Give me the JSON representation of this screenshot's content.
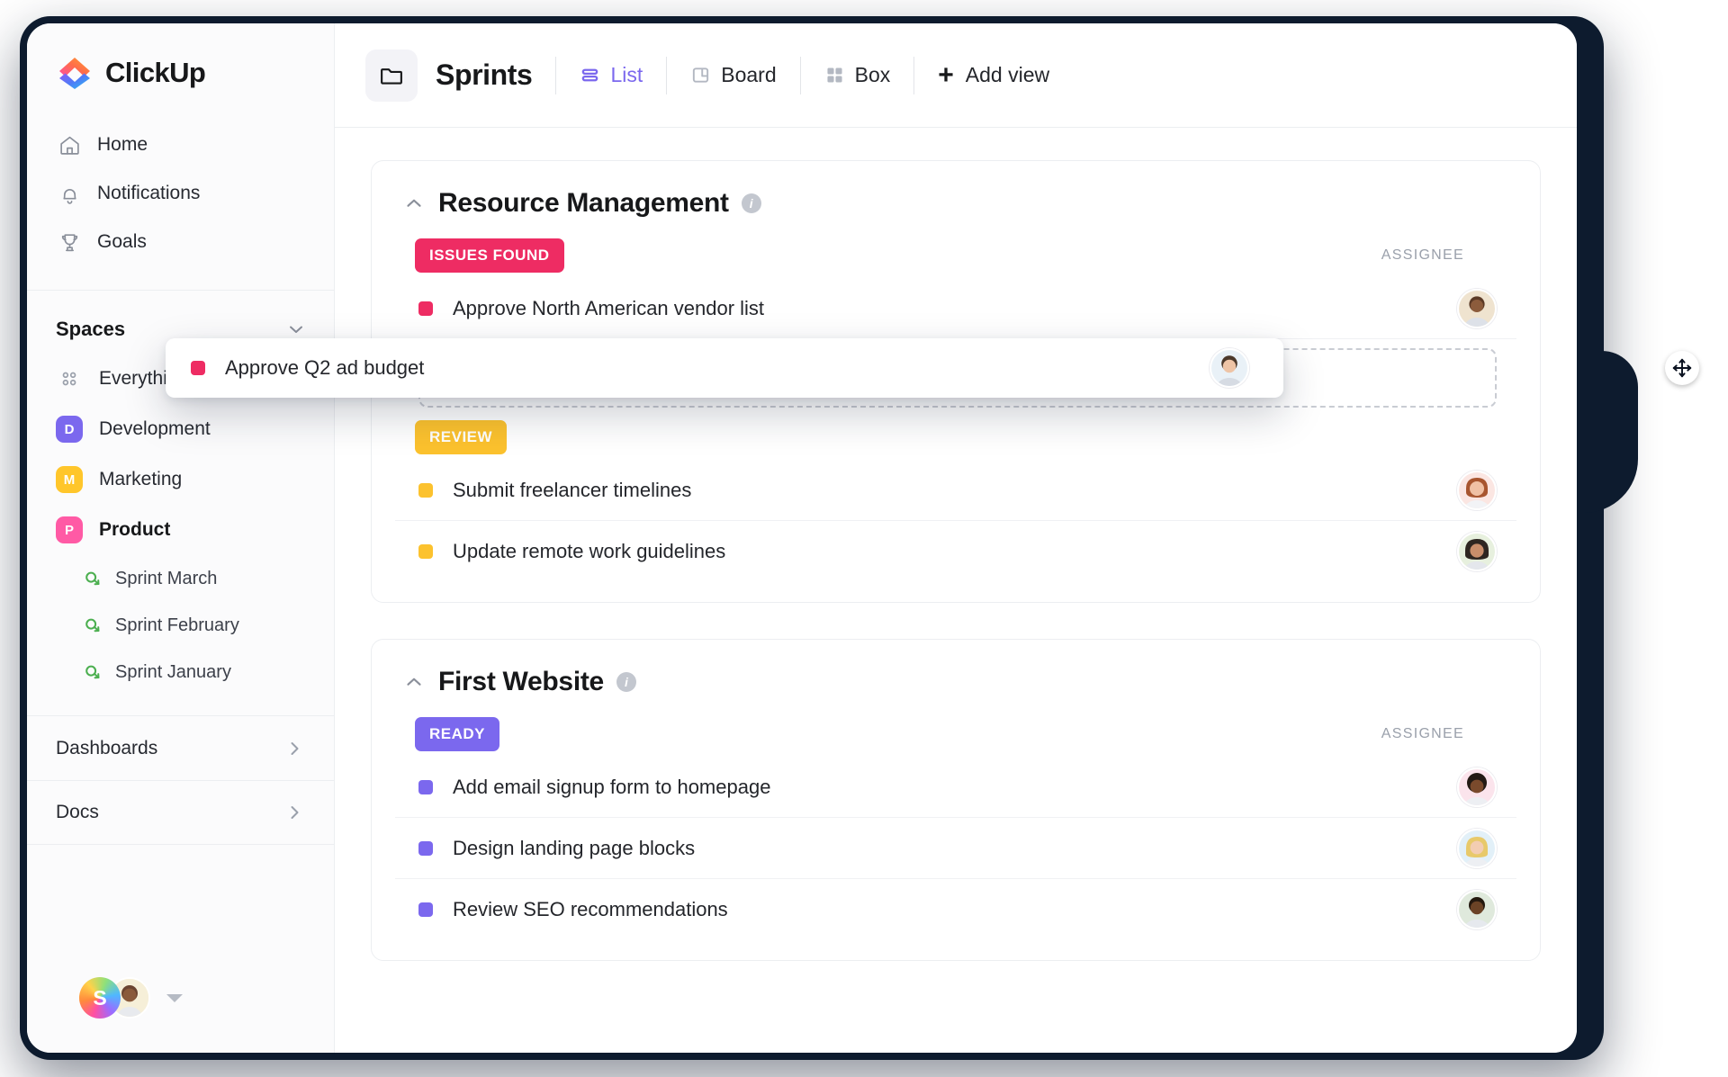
{
  "app": {
    "brand": "ClickUp",
    "logo_icon": "clickup-logo-icon"
  },
  "sidebar": {
    "nav": [
      {
        "label": "Home",
        "icon": "home-icon"
      },
      {
        "label": "Notifications",
        "icon": "bell-icon"
      },
      {
        "label": "Goals",
        "icon": "trophy-icon"
      }
    ],
    "spaces_title": "Spaces",
    "spaces_chevron_icon": "chevron-down-icon",
    "everything": {
      "label": "Everything",
      "icon": "grid-dots-icon"
    },
    "spaces": [
      {
        "label": "Development",
        "initial": "D",
        "color": "#7B68EE",
        "active": false
      },
      {
        "label": "Marketing",
        "initial": "M",
        "color": "#FFC62B",
        "active": false
      },
      {
        "label": "Product",
        "initial": "P",
        "color": "#FF5AA5",
        "active": true
      }
    ],
    "sprints": [
      {
        "label": "Sprint  March",
        "icon": "sprint-icon"
      },
      {
        "label": "Sprint  February",
        "icon": "sprint-icon"
      },
      {
        "label": "Sprint January",
        "icon": "sprint-icon"
      }
    ],
    "bottom": [
      {
        "label": "Dashboards",
        "icon": "chevron-right-icon"
      },
      {
        "label": "Docs",
        "icon": "chevron-right-icon"
      }
    ],
    "user": {
      "workspace_initial": "S",
      "avatar_icon": "user-avatar",
      "caret_icon": "caret-down-icon"
    }
  },
  "topbar": {
    "folder_icon": "folder-icon",
    "title": "Sprints",
    "views": [
      {
        "label": "List",
        "icon": "list-view-icon",
        "active": true
      },
      {
        "label": "Board",
        "icon": "board-view-icon",
        "active": false
      },
      {
        "label": "Box",
        "icon": "box-view-icon",
        "active": false
      }
    ],
    "add_view": {
      "label": "Add view",
      "icon": "plus-icon"
    }
  },
  "groups": [
    {
      "title": "Resource Management",
      "collapse_icon": "chevron-up-icon",
      "info_icon": "info-icon",
      "assignee_header": "ASSIGNEE",
      "statuses": [
        {
          "label": "ISSUES FOUND",
          "color": "#EE2C63",
          "dot_color": "#EE2C63",
          "tasks": [
            {
              "name": "Approve North American vendor list",
              "assignee": "avatar-1"
            }
          ],
          "has_drop_placeholder": true
        },
        {
          "label": "REVIEW",
          "color": "#FCC22E",
          "dot_color": "#FCC22E",
          "tasks": [
            {
              "name": "Submit freelancer timelines",
              "assignee": "avatar-2"
            },
            {
              "name": "Update remote work guidelines",
              "assignee": "avatar-3"
            }
          ],
          "has_drop_placeholder": false
        }
      ]
    },
    {
      "title": "First Website",
      "collapse_icon": "chevron-up-icon",
      "info_icon": "info-icon",
      "assignee_header": "ASSIGNEE",
      "statuses": [
        {
          "label": "READY",
          "color": "#7B68EE",
          "dot_color": "#7B68EE",
          "tasks": [
            {
              "name": "Add email signup form to homepage",
              "assignee": "avatar-4"
            },
            {
              "name": "Design landing page blocks",
              "assignee": "avatar-5"
            },
            {
              "name": "Review SEO recommendations",
              "assignee": "avatar-6"
            }
          ],
          "has_drop_placeholder": false
        }
      ]
    }
  ],
  "drag_card": {
    "task_name": "Approve Q2 ad budget",
    "dot_color": "#EE2C63",
    "assignee": "avatar-drag",
    "cursor_icon": "move-cursor-icon"
  }
}
